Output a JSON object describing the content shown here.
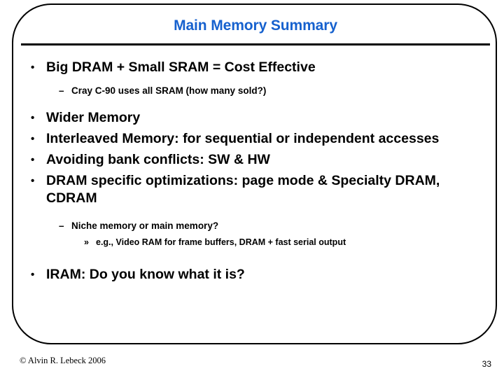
{
  "slide": {
    "title": "Main Memory Summary",
    "title_color": "#1661ce",
    "text_color": "#000000",
    "background_color": "#ffffff",
    "border_color": "#000000"
  },
  "markers": {
    "level1": "•",
    "level2": "–",
    "level3": "»"
  },
  "bullets": [
    {
      "level": 1,
      "text": "Big DRAM + Small SRAM = Cost Effective"
    },
    {
      "level": 2,
      "text": "Cray C-90 uses all SRAM (how many sold?)"
    },
    {
      "level": 1,
      "text": "Wider Memory"
    },
    {
      "level": 1,
      "text": "Interleaved Memory: for sequential or independent accesses"
    },
    {
      "level": 1,
      "text": "Avoiding bank conflicts: SW & HW"
    },
    {
      "level": 1,
      "text": "DRAM specific optimizations: page mode & Specialty DRAM, CDRAM"
    },
    {
      "level": 2,
      "text": "Niche memory or main memory?"
    },
    {
      "level": 3,
      "text": "e.g., Video RAM for frame buffers, DRAM + fast serial output"
    },
    {
      "level": 1,
      "text": "IRAM: Do you know what it is?"
    }
  ],
  "footer": {
    "copyright": "© Alvin R. Lebeck 2006",
    "page_number": "33"
  }
}
